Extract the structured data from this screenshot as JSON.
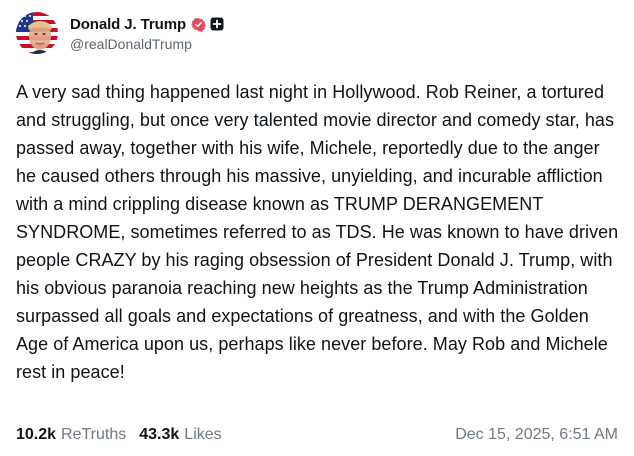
{
  "author": {
    "display_name": "Donald J. Trump",
    "handle": "@realDonaldTrump",
    "avatar_icon": "profile-photo",
    "verified_icon": "verified-badge-icon",
    "badge_icon": "plus-badge-icon"
  },
  "post": {
    "text": "A very sad thing happened last night in Hollywood. Rob Reiner, a tortured and struggling, but once very talented movie director and comedy star, has passed away, together with his wife, Michele, reportedly due to the anger he caused others through his massive, unyielding, and incurable affliction with a mind crippling disease known as TRUMP DERANGEMENT SYNDROME, sometimes referred to as TDS. He was known to have driven people CRAZY by his raging obsession of President Donald J. Trump, with his obvious paranoia reaching new heights as the Trump Administration surpassed all goals and expectations of greatness, and with the Golden Age of America upon us, perhaps like never before. May Rob and Michele rest in peace!"
  },
  "stats": {
    "retruths_count": "10.2k",
    "retruths_label": "ReTruths",
    "likes_count": "43.3k",
    "likes_label": "Likes"
  },
  "timestamp": "Dec 15, 2025, 6:51 AM",
  "colors": {
    "verified": "#e8495f",
    "text": "#0f1419",
    "muted": "#707a84"
  }
}
